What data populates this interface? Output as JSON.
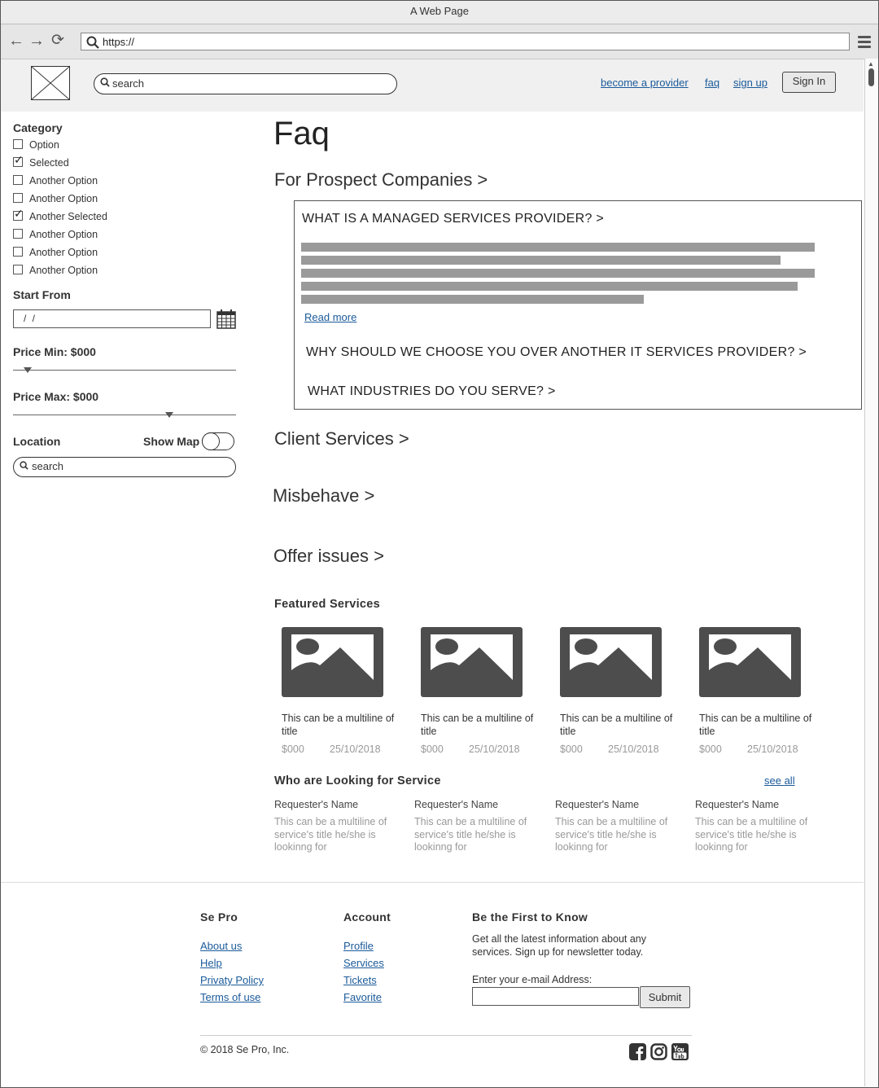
{
  "browser": {
    "title": "A Web Page",
    "url": "https://"
  },
  "header": {
    "search_placeholder": "search",
    "links": [
      "become a provider",
      "faq",
      "sign up"
    ],
    "sign_in": "Sign In"
  },
  "sidebar": {
    "category_title": "Category",
    "options": [
      {
        "label": "Option",
        "checked": false
      },
      {
        "label": "Selected",
        "checked": true
      },
      {
        "label": "Another Option",
        "checked": false
      },
      {
        "label": "Another Option",
        "checked": false
      },
      {
        "label": "Another Selected",
        "checked": true
      },
      {
        "label": "Another Option",
        "checked": false
      },
      {
        "label": "Another Option",
        "checked": false
      },
      {
        "label": "Another Option",
        "checked": false
      }
    ],
    "start_from_title": "Start From",
    "date_value": "/ /",
    "price_min_label": "Price Min: $000",
    "price_max_label": "Price Max: $000",
    "location_title": "Location",
    "show_map_label": "Show Map",
    "location_search_placeholder": "search"
  },
  "main": {
    "title": "Faq",
    "sections": {
      "prospect": "For Prospect Companies >",
      "client": "Client Services >",
      "misbehave": "Misbehave >",
      "offer": "Offer issues >"
    },
    "faq": {
      "q1": "WHAT IS A MANAGED SERVICES PROVIDER? >",
      "read_more": "Read more",
      "q2": "WHY SHOULD WE CHOOSE YOU OVER ANOTHER IT SERVICES PROVIDER? >",
      "q3": "WHAT INDUSTRIES DO YOU SERVE? >"
    },
    "featured_title": "Featured Services",
    "featured": [
      {
        "title": "This can be a multiline of title",
        "price": "$000",
        "date": "25/10/2018"
      },
      {
        "title": "This can be a multiline of title",
        "price": "$000",
        "date": "25/10/2018"
      },
      {
        "title": "This can be a multiline of title",
        "price": "$000",
        "date": "25/10/2018"
      },
      {
        "title": "This can be a multiline of title",
        "price": "$000",
        "date": "25/10/2018"
      }
    ],
    "looking_title": "Who are Looking for Service",
    "see_all": "see all",
    "requesters": [
      {
        "name": "Requester's Name",
        "desc": "This can be a multiline of service's title he/she is lookinng for"
      },
      {
        "name": "Requester's Name",
        "desc": "This can be a multiline of service's title he/she is lookinng for"
      },
      {
        "name": "Requester's Name",
        "desc": "This can be a multiline of service's title he/she is lookinng for"
      },
      {
        "name": "Requester's Name",
        "desc": "This can be a multiline of service's title he/she is lookinng for"
      }
    ]
  },
  "footer": {
    "col1_title": "Se Pro",
    "col1_links": [
      "About us",
      "Help",
      "Privaty Policy",
      "Terms of use"
    ],
    "col2_title": "Account",
    "col2_links": [
      "Profile",
      "Services",
      "Tickets",
      "Favorite"
    ],
    "newsletter_title": "Be the First to Know",
    "newsletter_desc": "Get all the latest information about any services. Sign up for newsletter today.",
    "email_label": "Enter your e-mail Address:",
    "submit": "Submit",
    "copyright": "© 2018 Se Pro, Inc.",
    "social_icons": [
      "facebook-icon",
      "instagram-icon",
      "youtube-icon"
    ]
  }
}
